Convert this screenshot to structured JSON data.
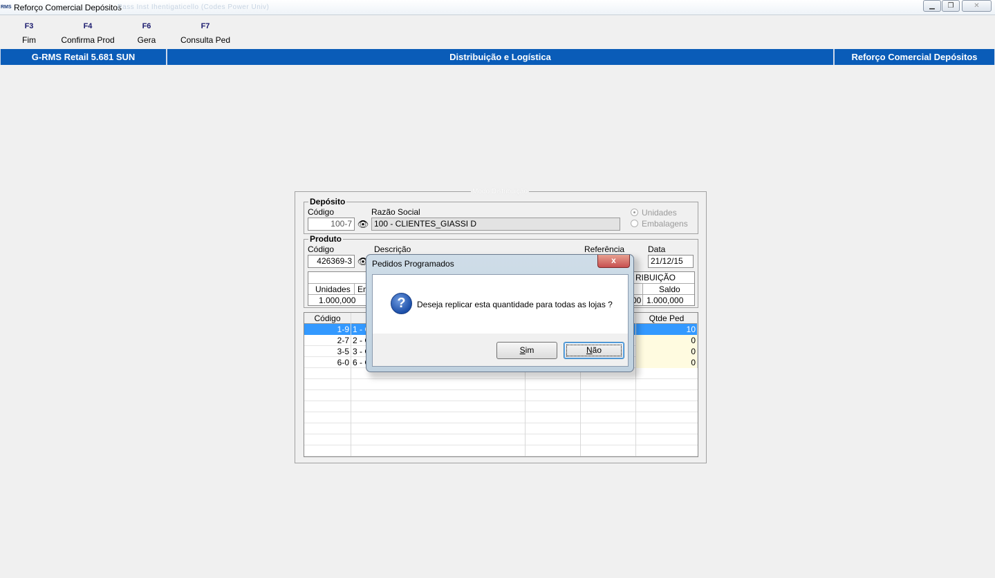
{
  "window": {
    "title": "Reforço Comercial Depósitos",
    "app_icon_text": "RMS",
    "ghost_text": "Pass Inst   Ihentigaticello (Codes  Power Univ)",
    "controls": [
      "minimize",
      "restore",
      "close"
    ]
  },
  "toolbar": {
    "items": [
      {
        "key": "F3",
        "label": "Fim"
      },
      {
        "key": "F4",
        "label": "Confirma Prod"
      },
      {
        "key": "F6",
        "label": "Gera"
      },
      {
        "key": "F7",
        "label": "Consulta Ped"
      }
    ]
  },
  "header": {
    "left": "G-RMS Retail 5.681 SUN",
    "center": "Distribuição e Logística",
    "right": "Reforço Comercial Depósitos",
    "color": "#0a5cb8"
  },
  "panel": {
    "title": "Modo Distribuição",
    "deposito": {
      "title": "Depósito",
      "codigo_label": "Código",
      "codigo_value": "100-7",
      "razao_label": "Razão Social",
      "razao_value": "100 - CLIENTES_GIASSI D",
      "radio_unidades": "Unidades",
      "radio_embalagens": "Embalagens"
    },
    "produto": {
      "title": "Produto",
      "codigo_label": "Código",
      "codigo_value": "426369-3",
      "descricao_label": "Descrição",
      "referencia_label": "Referência",
      "data_label": "Data",
      "data_value": "21/12/15",
      "table": {
        "left_headers": [
          "Unidades",
          "Em"
        ],
        "left_values": [
          "1.000,000"
        ],
        "right_group_header": "RIBUIÇÃO",
        "right_header": "Saldo",
        "right_partial_value": "00",
        "right_value": "1.000,000"
      }
    },
    "grid": {
      "headers": {
        "codigo": "Código",
        "qtde": "Qtde Ped"
      },
      "rows": [
        {
          "codigo": "1-9",
          "desc": "1 - C",
          "qtde": "10",
          "selected": true
        },
        {
          "codigo": "2-7",
          "desc": "2 - C",
          "qtde": "0",
          "selected": false
        },
        {
          "codigo": "3-5",
          "desc": "3 - C",
          "qtde": "0",
          "selected": false
        },
        {
          "codigo": "6-0",
          "desc": "6 - C",
          "qtde": "0",
          "selected": false
        }
      ],
      "selected_color": "#3399ff"
    }
  },
  "dialog": {
    "title": "Pedidos Programados",
    "close_glyph": "x",
    "icon": "question-icon",
    "message": "Deseja replicar esta quantidade para todas as lojas ?",
    "yes_accel": "S",
    "yes_rest": "im",
    "no_accel": "N",
    "no_rest": "ão"
  }
}
